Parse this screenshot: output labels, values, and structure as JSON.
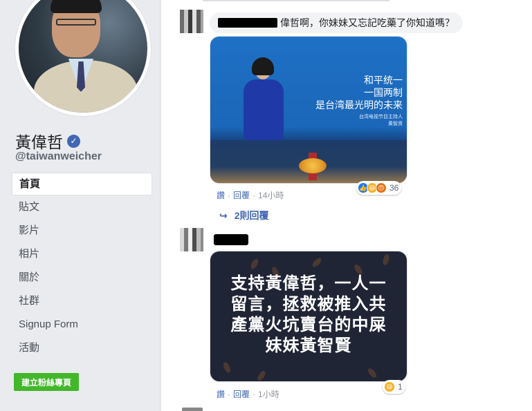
{
  "sidebar": {
    "page_name": "黃偉哲",
    "handle": "@taiwanweicher",
    "nav": [
      {
        "label": "首頁",
        "active": true
      },
      {
        "label": "貼文"
      },
      {
        "label": "影片"
      },
      {
        "label": "相片"
      },
      {
        "label": "關於"
      },
      {
        "label": "社群"
      },
      {
        "label": "Signup Form"
      },
      {
        "label": "活動"
      }
    ],
    "create_page_label": "建立粉絲專頁"
  },
  "comments": [
    {
      "text": "偉哲啊，你妹妹又忘記吃藥了你知道嗎？",
      "image": {
        "slogan_lines": [
          "和平统一",
          "一国两制",
          "是台湾最光明的未来"
        ],
        "caption_lines": [
          "台湾电视节目主持人",
          "黄智贤"
        ]
      },
      "actions": {
        "like": "讚",
        "reply": "回覆",
        "time": "14小時"
      },
      "reactions": {
        "count": "36",
        "types": [
          "like-icon",
          "haha-icon",
          "angry-icon"
        ]
      },
      "replies_label": "2則回覆"
    },
    {
      "image": {
        "quote_lines": [
          "支持黃偉哲，一人一",
          "留言，拯救被推入共",
          "產黨火坑賣台的中屎",
          "妹妹黃智賢"
        ]
      },
      "actions": {
        "like": "讚",
        "reply": "回覆",
        "time": "1小時"
      },
      "reactions": {
        "count": "1",
        "types": [
          "haha-icon"
        ]
      }
    }
  ],
  "colors": {
    "link": "#4267b2",
    "create_button": "#42b72a",
    "verified": "#4267b2"
  }
}
